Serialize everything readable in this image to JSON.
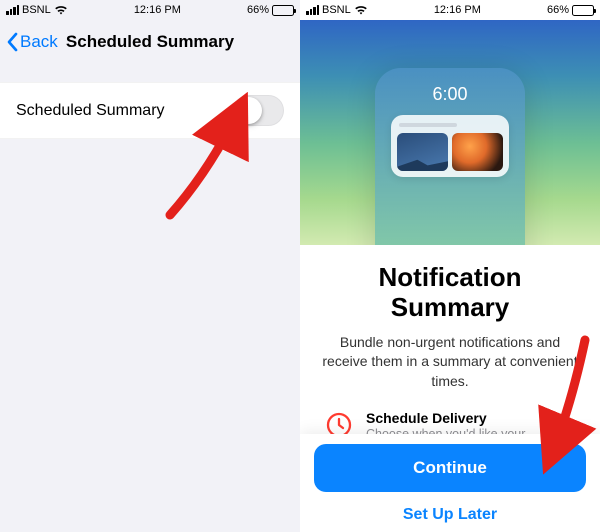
{
  "status": {
    "carrier": "BSNL",
    "time": "12:16 PM",
    "battery_pct": "66%"
  },
  "left": {
    "back_label": "Back",
    "title": "Scheduled Summary",
    "row_label": "Scheduled Summary"
  },
  "right": {
    "hero_time": "6:00",
    "heading": "Notification Summary",
    "body": "Bundle non-urgent notifications and receive them in a summary at convenient times.",
    "feature_title": "Schedule Delivery",
    "feature_sub": "Choose when you'd like your notification summary to a",
    "continue": "Continue",
    "later": "Set Up Later"
  }
}
